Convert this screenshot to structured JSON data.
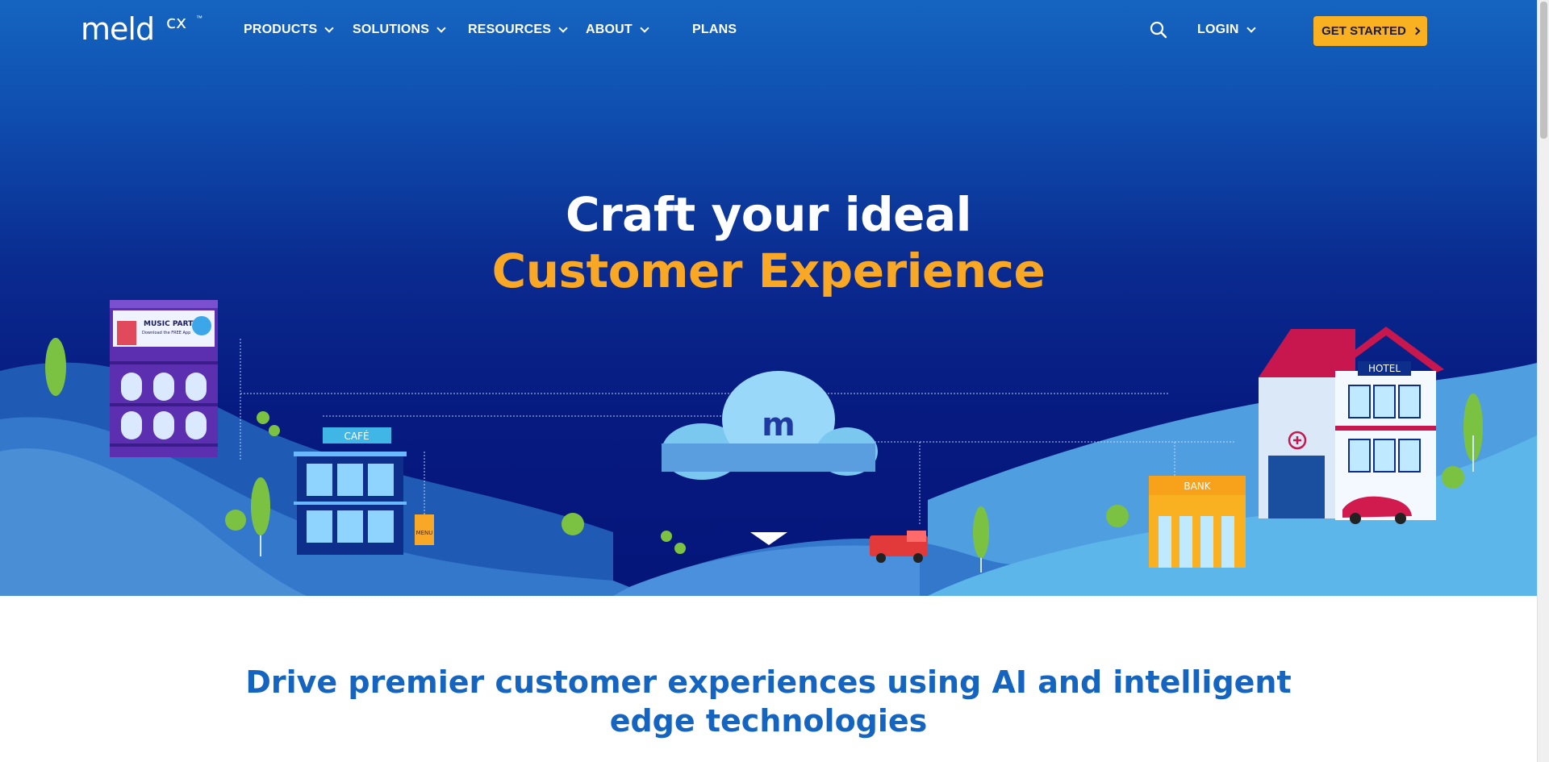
{
  "brand": {
    "wordmark": "meld",
    "suffix": "cx",
    "trademark": "™"
  },
  "nav": {
    "items": [
      {
        "label": "PRODUCTS",
        "has_dropdown": true
      },
      {
        "label": "SOLUTIONS",
        "has_dropdown": true
      },
      {
        "label": "RESOURCES",
        "has_dropdown": true
      },
      {
        "label": "ABOUT",
        "has_dropdown": true
      },
      {
        "label": "PLANS",
        "has_dropdown": false
      }
    ],
    "search_icon": "search-icon",
    "login_label": "LOGIN",
    "cta_label": "GET STARTED"
  },
  "hero": {
    "line1": "Craft your ideal",
    "line2": "Customer Experience",
    "colors": {
      "line1": "#ffffff",
      "line2": "#f9a825",
      "cta": "#f9b122",
      "background": "#0a2a8f"
    },
    "scene": {
      "billboard_title": "MUSIC PARTY",
      "billboard_sub": "Download the FREE App",
      "cafe_sign": "CAFÉ",
      "menu_sign": "MENU",
      "cloud_letter": "m",
      "bank_sign": "BANK",
      "hotel_sign": "HOTEL"
    }
  },
  "section": {
    "heading": "Drive premier customer experiences using AI and intelligent edge technologies"
  }
}
